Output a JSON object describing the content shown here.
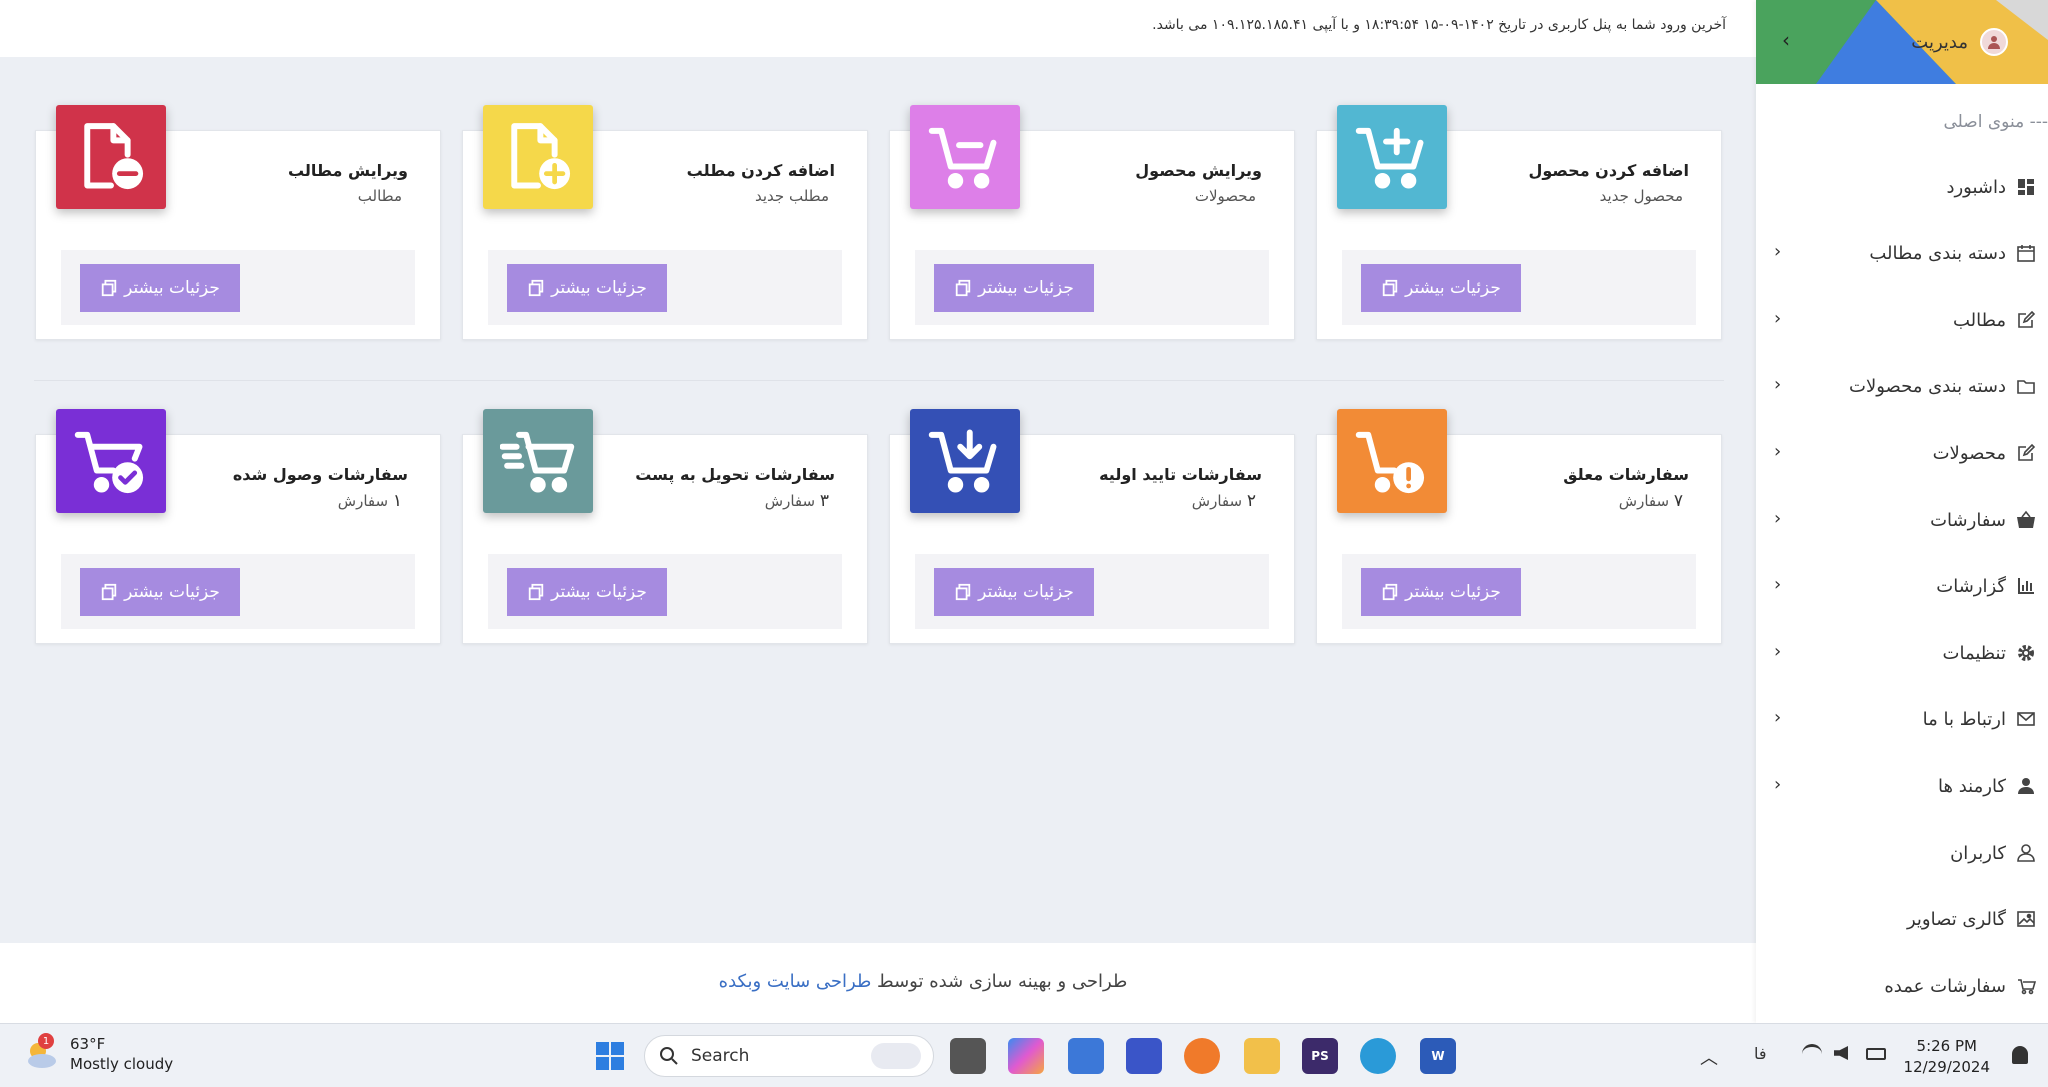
{
  "topbar": {
    "last_login": "آخرین ورود شما به پنل کاربری در تاریخ ۱۴۰۲-۰۹-۱۵ ۱۸:۳۹:۵۴ و با آیپی ۱۰۹.۱۲۵.۱۸۵.۴۱ می باشد."
  },
  "cards": [
    {
      "title": "اضافه کردن محصول",
      "subtitle": "محصول جدید",
      "button": "جزئیات بیشتر",
      "icon": "cart-plus-icon",
      "color": "#52b7d2"
    },
    {
      "title": "ویرایش محصول",
      "subtitle": "محصولات",
      "button": "جزئیات بیشتر",
      "icon": "cart-minus-icon",
      "color": "#dd7fe8"
    },
    {
      "title": "اضافه کردن مطلب",
      "subtitle": "مطلب جدید",
      "button": "جزئیات بیشتر",
      "icon": "file-plus-icon",
      "color": "#f5d84a"
    },
    {
      "title": "ویرایش مطالب",
      "subtitle": "مطالب",
      "button": "جزئیات بیشتر",
      "icon": "file-minus-icon",
      "color": "#d0334a"
    },
    {
      "title": "سفارشات معلق",
      "count": "۷",
      "unit": "سفارش",
      "button": "جزئیات بیشتر",
      "icon": "cart-alert-icon",
      "color": "#f28b36"
    },
    {
      "title": "سفارشات تایید اولیه",
      "count": "۲",
      "unit": "سفارش",
      "button": "جزئیات بیشتر",
      "icon": "cart-download-icon",
      "color": "#3450b5"
    },
    {
      "title": "سفارشات تحویل به پست",
      "count": "۳",
      "unit": "سفارش",
      "button": "جزئیات بیشتر",
      "icon": "cart-fast-icon",
      "color": "#6a9a9b"
    },
    {
      "title": "سفارشات وصول شده",
      "count": "۱",
      "unit": "سفارش",
      "button": "جزئیات بیشتر",
      "icon": "cart-check-icon",
      "color": "#7a2fd6"
    }
  ],
  "footer": {
    "text": "طراحی و بهینه سازی شده توسط",
    "link": "طراحی سایت وبکده"
  },
  "sidebar": {
    "user": "مدیریت",
    "section": "--- منوی اصلی",
    "items": [
      {
        "label": "داشبورد",
        "icon": "dashboard-icon",
        "arrow": false
      },
      {
        "label": "دسته بندی مطالب",
        "icon": "calendar-icon",
        "arrow": true
      },
      {
        "label": "مطالب",
        "icon": "edit-icon",
        "arrow": true
      },
      {
        "label": "دسته بندی محصولات",
        "icon": "folder-icon",
        "arrow": true
      },
      {
        "label": "محصولات",
        "icon": "edit-icon",
        "arrow": true
      },
      {
        "label": "سفارشات",
        "icon": "basket-icon",
        "arrow": true
      },
      {
        "label": "گزارشات",
        "icon": "bar-chart-icon",
        "arrow": true
      },
      {
        "label": "تنظیمات",
        "icon": "gear-icon",
        "arrow": true
      },
      {
        "label": "ارتباط با ما",
        "icon": "envelope-icon",
        "arrow": true
      },
      {
        "label": "کارمند ها",
        "icon": "user-icon",
        "arrow": true
      },
      {
        "label": "کاربران",
        "icon": "user-outline-icon",
        "arrow": false
      },
      {
        "label": "گالری تصاویر",
        "icon": "image-icon",
        "arrow": false
      },
      {
        "label": "سفارشات عمده",
        "icon": "truck-icon",
        "arrow": false
      }
    ]
  },
  "taskbar": {
    "weather_temp": "63°F",
    "weather_desc": "Mostly cloudy",
    "weather_badge": "1",
    "search_placeholder": "Search",
    "lang": "فا",
    "time": "5:26 PM",
    "date": "12/29/2024"
  }
}
